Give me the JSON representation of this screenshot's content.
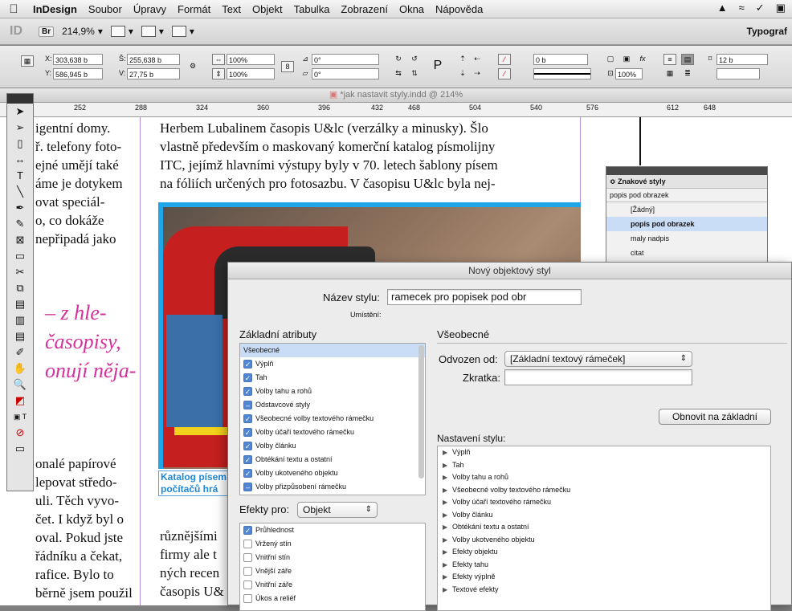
{
  "menubar": {
    "apple": "",
    "app": "InDesign",
    "items": [
      "Soubor",
      "Úpravy",
      "Formát",
      "Text",
      "Objekt",
      "Tabulka",
      "Zobrazení",
      "Okna",
      "Nápověda"
    ]
  },
  "appbar": {
    "logo": "ID",
    "br": "Br",
    "zoom": "214,9%",
    "workspace": "Typograf"
  },
  "control": {
    "x_label": "X:",
    "x_value": "303,638 b",
    "y_label": "Y:",
    "y_value": "586,945 b",
    "w_label": "Š:",
    "w_value": "255,638 b",
    "h_label": "V:",
    "h_value": "27,75 b",
    "scale_x": "100%",
    "scale_y": "100%",
    "rotate": "0°",
    "shear": "0°",
    "stroke": "0 b",
    "percent": "100%",
    "columns": "12 b"
  },
  "document": {
    "title": "*jak nastavit styly.indd @ 214%",
    "ruler": [
      "252",
      "288",
      "324",
      "360",
      "396",
      "432",
      "468",
      "504",
      "540",
      "576",
      "612",
      "648"
    ],
    "left_column": [
      "igentní domy.",
      "ř. telefony foto-",
      "ejné umějí také",
      "áme je dotykem",
      "ovat speciál-",
      "o, co dokáže",
      "nepřipadá jako"
    ],
    "left_magenta": [
      "– z hle-",
      "časopisy,",
      "onují něja-"
    ],
    "left_bottom": [
      "onalé papírové",
      "lepovat středo-",
      "uli. Těch vyvo-",
      "čet. I když byl o",
      "oval. Pokud jste",
      "řádníku a čekat,",
      "rafice. Bylo to",
      "běrně jsem použil"
    ],
    "main_text": [
      "Herbem Lubalinem  časopis U&lc (verzálky a minusky). Šlo",
      "vlastně především o maskovaný komerční katalog písmolijny",
      "ITC, jejímž hlavními výstupy byly v 70. letech šablony písem",
      "na fóliích určených pro fotosazbu. V časopisu U&lc byla nej-"
    ],
    "caption": [
      "Katalog písem",
      "počítačů hrá"
    ],
    "lower_text": [
      "různějšími",
      "firmy ale t",
      "ných recen",
      "časopis U&"
    ]
  },
  "char_styles": {
    "tab": "≎ Znakové styly",
    "current": "popis pod obrazek",
    "items": [
      "[Žádný]",
      "popis pod obrazek",
      "maly nadpis",
      "citat"
    ]
  },
  "dialog": {
    "title": "Nový objektový styl",
    "name_label": "Název stylu:",
    "name_value": "ramecek pro popisek pod obr",
    "location_label": "Umístění:",
    "basic_header": "Základní atributy",
    "attributes": [
      {
        "label": "Všeobecné",
        "state": "none"
      },
      {
        "label": "Výplň",
        "state": "checked"
      },
      {
        "label": "Tah",
        "state": "checked"
      },
      {
        "label": "Volby tahu a rohů",
        "state": "checked"
      },
      {
        "label": "Odstavcové styly",
        "state": "minus"
      },
      {
        "label": "Všeobecné volby textového rámečku",
        "state": "checked"
      },
      {
        "label": "Volby účaří textového rámečku",
        "state": "checked"
      },
      {
        "label": "Volby článku",
        "state": "checked"
      },
      {
        "label": "Obtékání textu a ostatní",
        "state": "checked"
      },
      {
        "label": "Volby ukotveného objektu",
        "state": "checked"
      },
      {
        "label": "Volby přizpůsobení rámečku",
        "state": "minus"
      }
    ],
    "effects_label": "Efekty pro:",
    "effects_value": "Objekt",
    "effects": [
      {
        "label": "Průhlednost",
        "state": "checked"
      },
      {
        "label": "Vržený stín",
        "state": "empty"
      },
      {
        "label": "Vnitřní stín",
        "state": "empty"
      },
      {
        "label": "Vnější záře",
        "state": "empty"
      },
      {
        "label": "Vnitřní záře",
        "state": "empty"
      },
      {
        "label": "Úkos a reliéf",
        "state": "empty"
      }
    ],
    "general_header": "Všeobecné",
    "based_on_label": "Odvozen od:",
    "based_on_value": "[Základní textový rámeček]",
    "shortcut_label": "Zkratka:",
    "shortcut_value": "",
    "reset_button": "Obnovit na základní",
    "settings_header": "Nastavení stylu:",
    "settings": [
      "Výplň",
      "Tah",
      "Volby tahu a rohů",
      "Všeobecné volby textového rámečku",
      "Volby účaří textového rámečku",
      "Volby článku",
      "Obtékání textu a ostatní",
      "Volby ukotveného objektu",
      "Efekty objektu",
      "Efekty tahu",
      "Efekty výplně",
      "Textové efekty"
    ]
  },
  "colors": {
    "accent": "#4f86d6",
    "caption": "#1e88d8",
    "magenta": "#d6309a",
    "frame": "#20a6e8"
  }
}
